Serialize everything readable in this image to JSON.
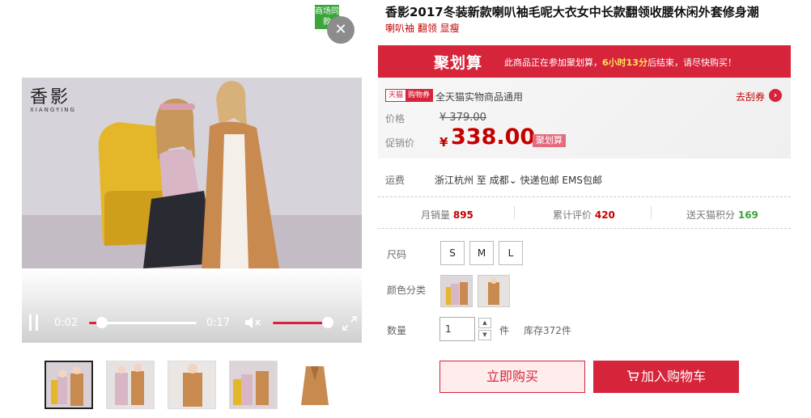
{
  "badge": {
    "text": "商场同款"
  },
  "brand": {
    "cn": "香影",
    "en": "XIANGYING"
  },
  "video": {
    "current_time": "0:02",
    "total_time": "0:17",
    "progress": 0.12,
    "volume": 0.95
  },
  "thumbnails": [
    "thumb-1",
    "thumb-2",
    "thumb-3",
    "thumb-4",
    "thumb-5"
  ],
  "product": {
    "title": "香影2017冬装新款喇叭袖毛呢大衣女中长款翻领收腰休闲外套修身潮",
    "subtitle": "喇叭袖 翻领 显瘦"
  },
  "juhuasuan": {
    "logo": "聚划算",
    "text_before": "此商品正在参加聚划算，",
    "time_left": "6小时13分",
    "text_after": "后结束，请尽快购买！"
  },
  "coupon": {
    "tag_a": "天猫",
    "tag_b": "购物券",
    "text": "全天猫实物商品通用",
    "link": "去刮券"
  },
  "price": {
    "label": "价格",
    "original": "¥ 379.00",
    "sale_label": "促销价",
    "currency": "¥",
    "sale": "338.00",
    "tag": "聚划算"
  },
  "shipping": {
    "label": "运费",
    "from": "浙江杭州",
    "to_word": "至",
    "dest": "成都",
    "options": "快递包邮  EMS包邮"
  },
  "stats": {
    "monthly_label": "月销量",
    "monthly": "895",
    "reviews_label": "累计评价",
    "reviews": "420",
    "points_label": "送天猫积分",
    "points": "169"
  },
  "size": {
    "label": "尺码",
    "options": [
      "S",
      "M",
      "L"
    ]
  },
  "color": {
    "label": "颜色分类"
  },
  "quantity": {
    "label": "数量",
    "value": "1",
    "unit": "件",
    "stock": "库存372件"
  },
  "actions": {
    "buy_now": "立即购买",
    "add_cart": "加入购物车"
  },
  "colors": {
    "accent": "#d6243b",
    "price": "#c40000",
    "green": "#3ba43b"
  }
}
